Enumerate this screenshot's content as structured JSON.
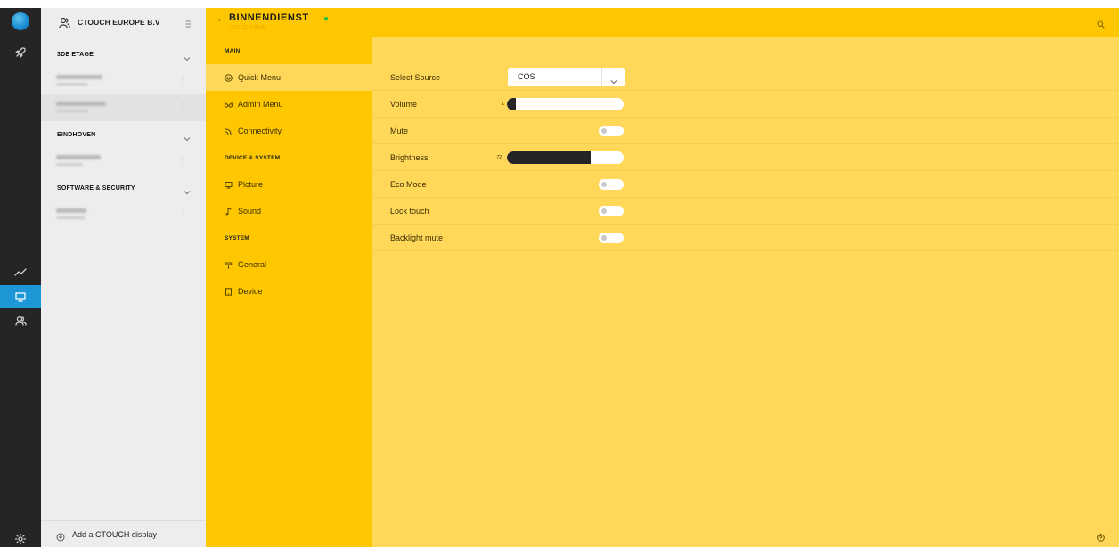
{
  "organization": {
    "name": "CTOUCH EUROPE B.V"
  },
  "device_groups": [
    {
      "label": "3DE ETAGE",
      "devices": [
        {
          "selected": false
        },
        {
          "selected": true
        }
      ]
    },
    {
      "label": "EINDHOVEN",
      "devices": [
        {
          "selected": false
        }
      ]
    },
    {
      "label": "SOFTWARE & SECURITY",
      "devices": [
        {
          "selected": false
        }
      ]
    }
  ],
  "add_display_label": "Add a CTOUCH display",
  "header": {
    "back": "←",
    "title": "BINNENDIENST",
    "subtitle": "CTOUCH-BNA",
    "status_color": "#19c24a"
  },
  "menu": {
    "sections": [
      {
        "label": "MAIN",
        "items": [
          {
            "label": "Quick Menu",
            "icon": "smiley-icon",
            "active": true
          },
          {
            "label": "Admin Menu",
            "icon": "glasses-icon"
          },
          {
            "label": "Connectivity",
            "icon": "signal-icon"
          }
        ]
      },
      {
        "label": "DEVICE & SYSTEM",
        "items": [
          {
            "label": "Picture",
            "icon": "monitor-icon"
          },
          {
            "label": "Sound",
            "icon": "music-note-icon"
          }
        ]
      },
      {
        "label": "SYSTEM",
        "items": [
          {
            "label": "General",
            "icon": "signpost-icon"
          },
          {
            "label": "Device",
            "icon": "tablet-icon"
          }
        ]
      }
    ]
  },
  "settings": {
    "select_source": {
      "label": "Select Source",
      "value": "COS"
    },
    "volume": {
      "label": "Volume",
      "value": "1",
      "level": 0.02
    },
    "mute": {
      "label": "Mute",
      "on": false
    },
    "brightness": {
      "label": "Brightness",
      "value": "72",
      "level": 0.72
    },
    "eco_mode": {
      "label": "Eco Mode",
      "on": false
    },
    "lock_touch": {
      "label": "Lock touch",
      "on": false
    },
    "backlight_mute": {
      "label": "Backlight mute",
      "on": false
    }
  },
  "colors": {
    "rail": "#252525",
    "accent_blue": "#1d97d6",
    "menu_yellow": "#fec700",
    "content_yellow": "#ffd85a"
  }
}
